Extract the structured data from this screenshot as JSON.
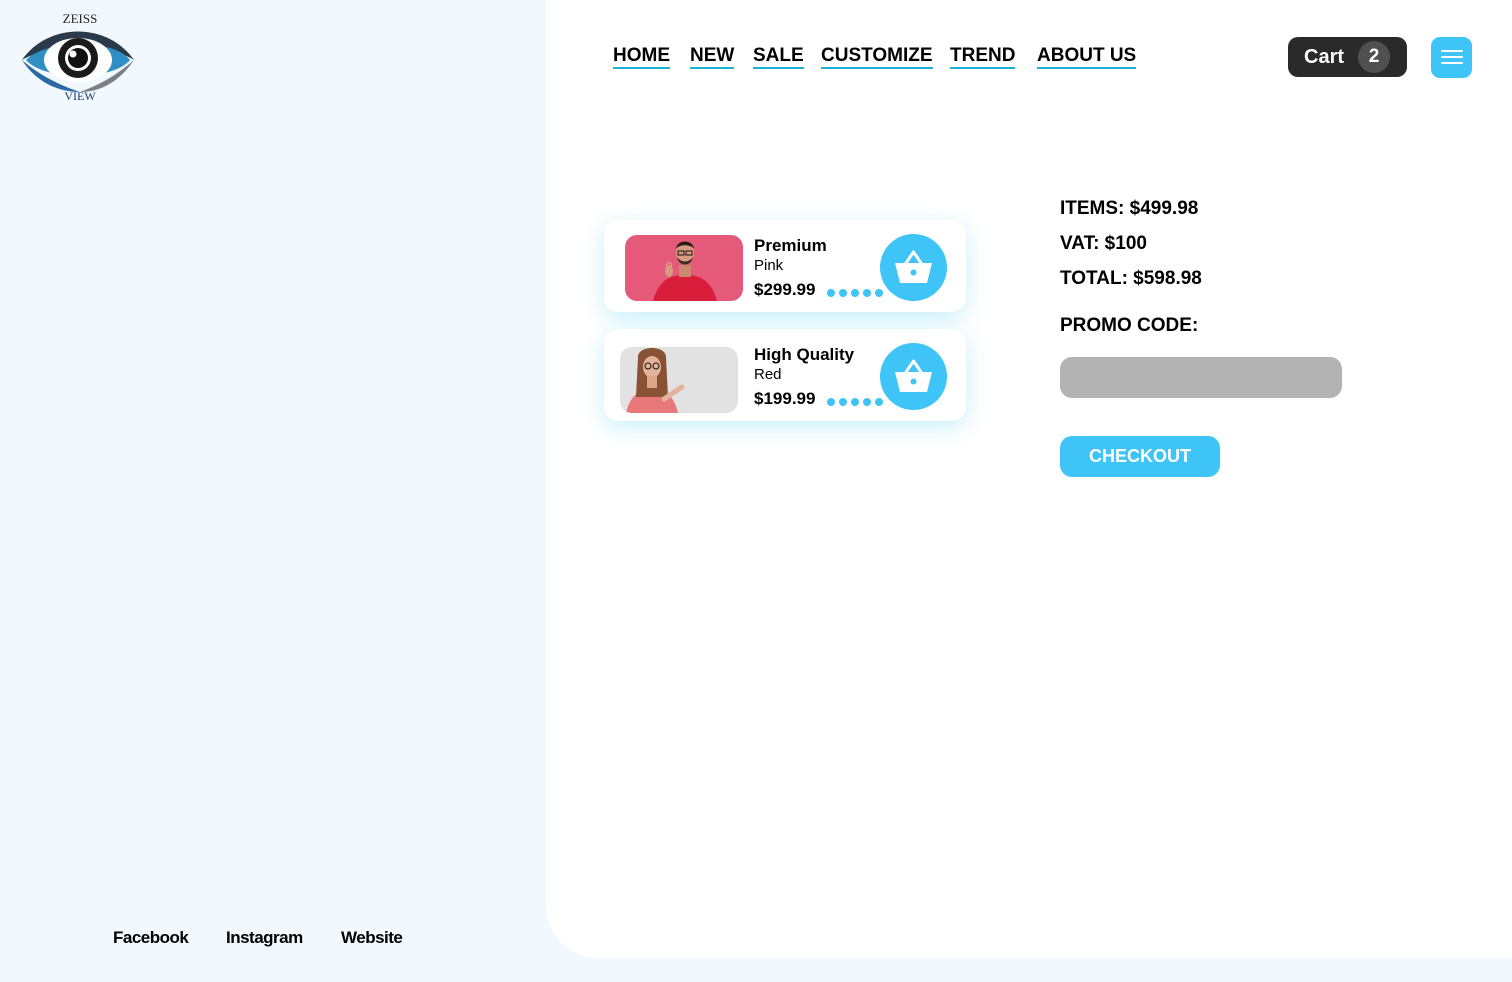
{
  "brand": {
    "logo_top": "ZEISS",
    "logo_bottom": "VIEW"
  },
  "nav": [
    "HOME",
    "NEW",
    "SALE",
    "CUSTOMIZE",
    "TREND",
    "ABOUT US"
  ],
  "cart": {
    "label": "Cart",
    "count": "2"
  },
  "menu": {
    "icon": "hamburger-icon"
  },
  "products": [
    {
      "name": "Premium",
      "color": "Pink",
      "price": "$299.99",
      "icon": "basket-icon"
    },
    {
      "name": "High Quality",
      "color": "Red",
      "price": "$199.99",
      "icon": "basket-icon"
    }
  ],
  "summary": {
    "items": "ITEMS: $499.98",
    "vat": "VAT: $100",
    "total": "TOTAL: $598.98",
    "promo_label": "PROMO CODE:",
    "promo_value": "",
    "checkout": "CHECKOUT"
  },
  "social": [
    "Facebook",
    "Instagram",
    "Website"
  ],
  "colors": {
    "accent": "#3ec4f6",
    "dark": "#2a2a2a",
    "bg": "#f1f8fe",
    "input": "#b3b3b3"
  }
}
